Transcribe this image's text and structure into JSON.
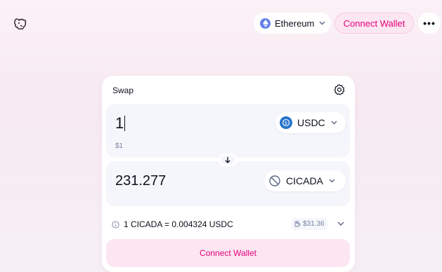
{
  "header": {
    "logo_icon": "unicorn-logo-icon",
    "network": {
      "label": "Ethereum",
      "icon": "ethereum-icon",
      "color": "#627eea"
    },
    "connect_label": "Connect Wallet",
    "more_label": "•••"
  },
  "swap": {
    "title": "Swap",
    "settings_icon": "gear-icon",
    "input": {
      "amount": "1",
      "fiat": "$1",
      "token": "USDC",
      "token_icon": "usdc-icon",
      "token_color": "#2775ca"
    },
    "output": {
      "amount": "231.277",
      "token": "CICADA",
      "token_icon": "unknown-token-icon"
    },
    "rate": "1 CICADA = 0.004324 USDC",
    "gas": "$31.36",
    "connect_label": "Connect Wallet"
  },
  "colors": {
    "accent": "#e5007a",
    "accent_bg": "#fce6f1",
    "panel_bg": "#f5f6fc"
  }
}
